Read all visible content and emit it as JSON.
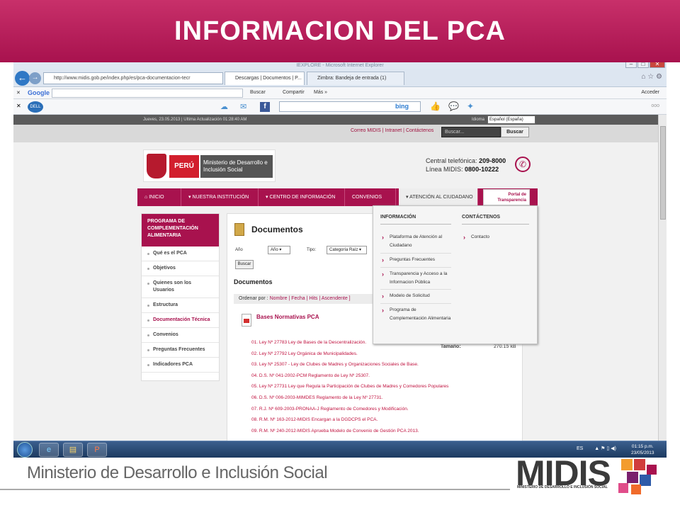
{
  "slide_title": "INFORMACION DEL PCA",
  "browser": {
    "window_title": "IEXPLORE - Microsoft Internet Explorer",
    "address": "http://www.midis.gob.pe/index.php/es/pca-documentacion-tecr",
    "tabs": [
      "Descargas | Documentos | P...",
      "Zimbra: Bandeja de entrada (1)"
    ],
    "google_label": "Google",
    "buscar_label": "Buscar",
    "compartir_label": "Compartir",
    "mas_label": "Más »",
    "acceder_label": "Acceder",
    "bing_label": "bing"
  },
  "site": {
    "topstrip_text": "Jueves, 23.05.2013  |  Ultima Actualización 01:28:40 AM",
    "idioma_label": "Idioma",
    "language": "Español (España)",
    "top_links": "Correo MIDIS | Intranet | Contáctenos",
    "search_placeholder": "Buscar...",
    "search_button": "Buscar",
    "logo_peru": "PERÚ",
    "logo_ministry": "Ministerio de Desarrollo e Inclusión Social",
    "central_label": "Central telefónica:",
    "central_number": "209-8000",
    "linea_label": "Línea MIDIS:",
    "linea_number": "0800-10222",
    "menu": [
      "INICIO",
      "NUESTRA INSTITUCIÓN",
      "CENTRO DE INFORMACIÓN",
      "CONVENIOS",
      "ATENCIÓN AL CIUDADANO"
    ],
    "portal_label": "Portal de Transparencia"
  },
  "sidebar": {
    "heading": "PROGRAMA DE COMPLEMENTACIÓN ALIMENTARIA",
    "items": [
      "Qué es el PCA",
      "Objetivos",
      "Quienes son los Usuarios",
      "Estructura",
      "Documentación Técnica",
      "Convenios",
      "Preguntas Frecuentes",
      "Indicadores PCA"
    ]
  },
  "main": {
    "title": "Documentos",
    "anio_label": "Año",
    "anio_value": "Año",
    "tipo_label": "Tipo:",
    "tipo_value": "Categoría Raíz",
    "buscar_button": "Buscar",
    "subtitle": "Documentos",
    "ordenar_label": "Ordenar por :",
    "ordenar_links": "Nombre | Fecha | Hits | Ascendente ]",
    "category_title": "Bases Normativas PCA",
    "tamano_label": "Tamaño:",
    "tamano_value": "270.15 kB",
    "documents": [
      "01. Ley Nº 27783 Ley de Bases de la Descentralización.",
      "02. Ley Nº 27792 Ley Orgánica de Municipalidades.",
      "03. Ley Nº 25307 - Ley de Clubes de Madres y Organizaciones Sociales de Base.",
      "04. D.S. Nº 041-2002-PCM Reglamento de Ley Nº 25307.",
      "05. Ley Nº 27731 Ley que Regula la Participación de Clubes de Madres y Comedores Populares",
      "06. D.S. Nº 006-2003-MIMDES Reglamento de la Ley Nº 27731.",
      "07. R.J. Nº 609-2003-PRONAA-J Reglamento de Comedores y Modificación.",
      "08. R.M. Nº 163-2012-MIDIS Encargan a la DGDCPS el PCA.",
      "09. R.M. Nº 240-2012-MIDIS Aprueba Modelo de Convenio de Gestión PCA 2013."
    ]
  },
  "dropdown": {
    "informacion_heading": "INFORMACIÓN",
    "contactenos_heading": "CONTÁCTENOS",
    "informacion_items": [
      "Plataforma de Atención al Ciudadano",
      "Preguntas Frecuentes",
      "Transparencia y Acceso a la Informacion Pública",
      "Modelo de Solicitud",
      "Programa de Complementación Alimentaria"
    ],
    "contacto_item": "Contacto"
  },
  "taskbar": {
    "lang": "ES",
    "time": "01:15 p.m.",
    "date": "23/05/2013"
  },
  "footer": {
    "ministry_text": "Ministerio de Desarrollo e Inclusión Social",
    "midis_logo": "MIDIS",
    "midis_sub": "MINISTERIO DE DESARROLLO E INCLUSIÓN SOCIAL"
  },
  "colors": {
    "brand": "#a8124e",
    "banner": "#c8306a"
  }
}
